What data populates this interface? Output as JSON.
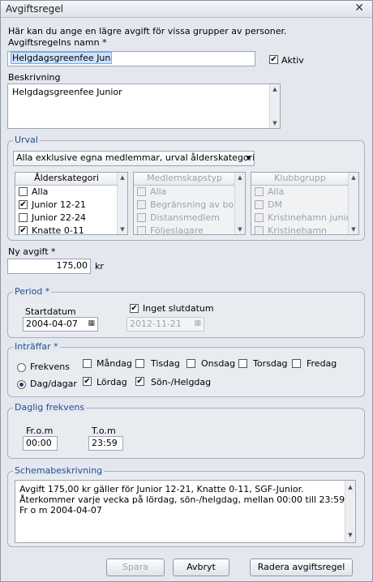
{
  "window": {
    "title": "Avgiftsregel",
    "close": "✕"
  },
  "intro": "Här kan du ange en lägre avgift för vissa grupper av personer.",
  "name": {
    "label": "Avgiftsregelns namn *",
    "value": "Helgdagsgreenfee Jun"
  },
  "active": {
    "label": "Aktiv",
    "checked": true
  },
  "description": {
    "label": "Beskrivning",
    "value": "Helgdagsgreenfee Junior"
  },
  "selection": {
    "title": "Urval",
    "dropdown": "Alla exklusive egna medlemmar, urval ålderskategori",
    "lists": [
      {
        "header": "Ålderskategori",
        "enabled": true,
        "items": [
          {
            "label": "Alla",
            "checked": false
          },
          {
            "label": "Junior 12-21",
            "checked": true
          },
          {
            "label": "Junior 22-24",
            "checked": false
          },
          {
            "label": "Knatte 0-11",
            "checked": true
          }
        ]
      },
      {
        "header": "Medlemskapstyp",
        "enabled": false,
        "items": [
          {
            "label": "Alla"
          },
          {
            "label": "Begränsning av bo"
          },
          {
            "label": "Distansmedlem"
          },
          {
            "label": "Följeslagare"
          }
        ]
      },
      {
        "header": "Klubbgrupp",
        "enabled": false,
        "items": [
          {
            "label": "Alla"
          },
          {
            "label": "DM"
          },
          {
            "label": "Kristinehamn junio"
          },
          {
            "label": "Kristinehamn"
          }
        ]
      }
    ]
  },
  "fee": {
    "label": "Ny avgift *",
    "value": "175,00",
    "unit": "kr"
  },
  "period": {
    "title": "Period *",
    "start_label": "Startdatum",
    "start_value": "2004-04-07",
    "no_end_label": "Inget slutdatum",
    "no_end_checked": true,
    "end_value": "2012-11-21"
  },
  "occurs": {
    "title": "Inträffar *",
    "frequency_label": "Frekvens",
    "days_label": "Dag/dagar",
    "selected": "days",
    "days": [
      {
        "label": "Måndag",
        "checked": false
      },
      {
        "label": "Tisdag",
        "checked": false
      },
      {
        "label": "Onsdag",
        "checked": false
      },
      {
        "label": "Torsdag",
        "checked": false
      },
      {
        "label": "Fredag",
        "checked": false
      },
      {
        "label": "Lördag",
        "checked": true
      },
      {
        "label": "Sön-/Helgdag",
        "checked": true
      }
    ]
  },
  "daily": {
    "title": "Daglig frekvens",
    "from_label": "Fr.o.m",
    "from_value": "00:00",
    "to_label": "T.o.m",
    "to_value": "23:59"
  },
  "schedule": {
    "title": "Schemabeskrivning",
    "lines": [
      "Avgift 175,00 kr gäller för Junior 12-21, Knatte 0-11, SGF-Junior.",
      "Återkommer varje vecka på lördag, sön-/helgdag, mellan 00:00 till 23:59",
      "Fr o m 2004-04-07"
    ]
  },
  "buttons": {
    "save": "Spara",
    "cancel": "Avbryt",
    "delete": "Radera avgiftsregel"
  },
  "icons": {
    "check": "✔",
    "calendar": "▦",
    "dropdown": "▾",
    "up": "▲",
    "down": "▼"
  }
}
